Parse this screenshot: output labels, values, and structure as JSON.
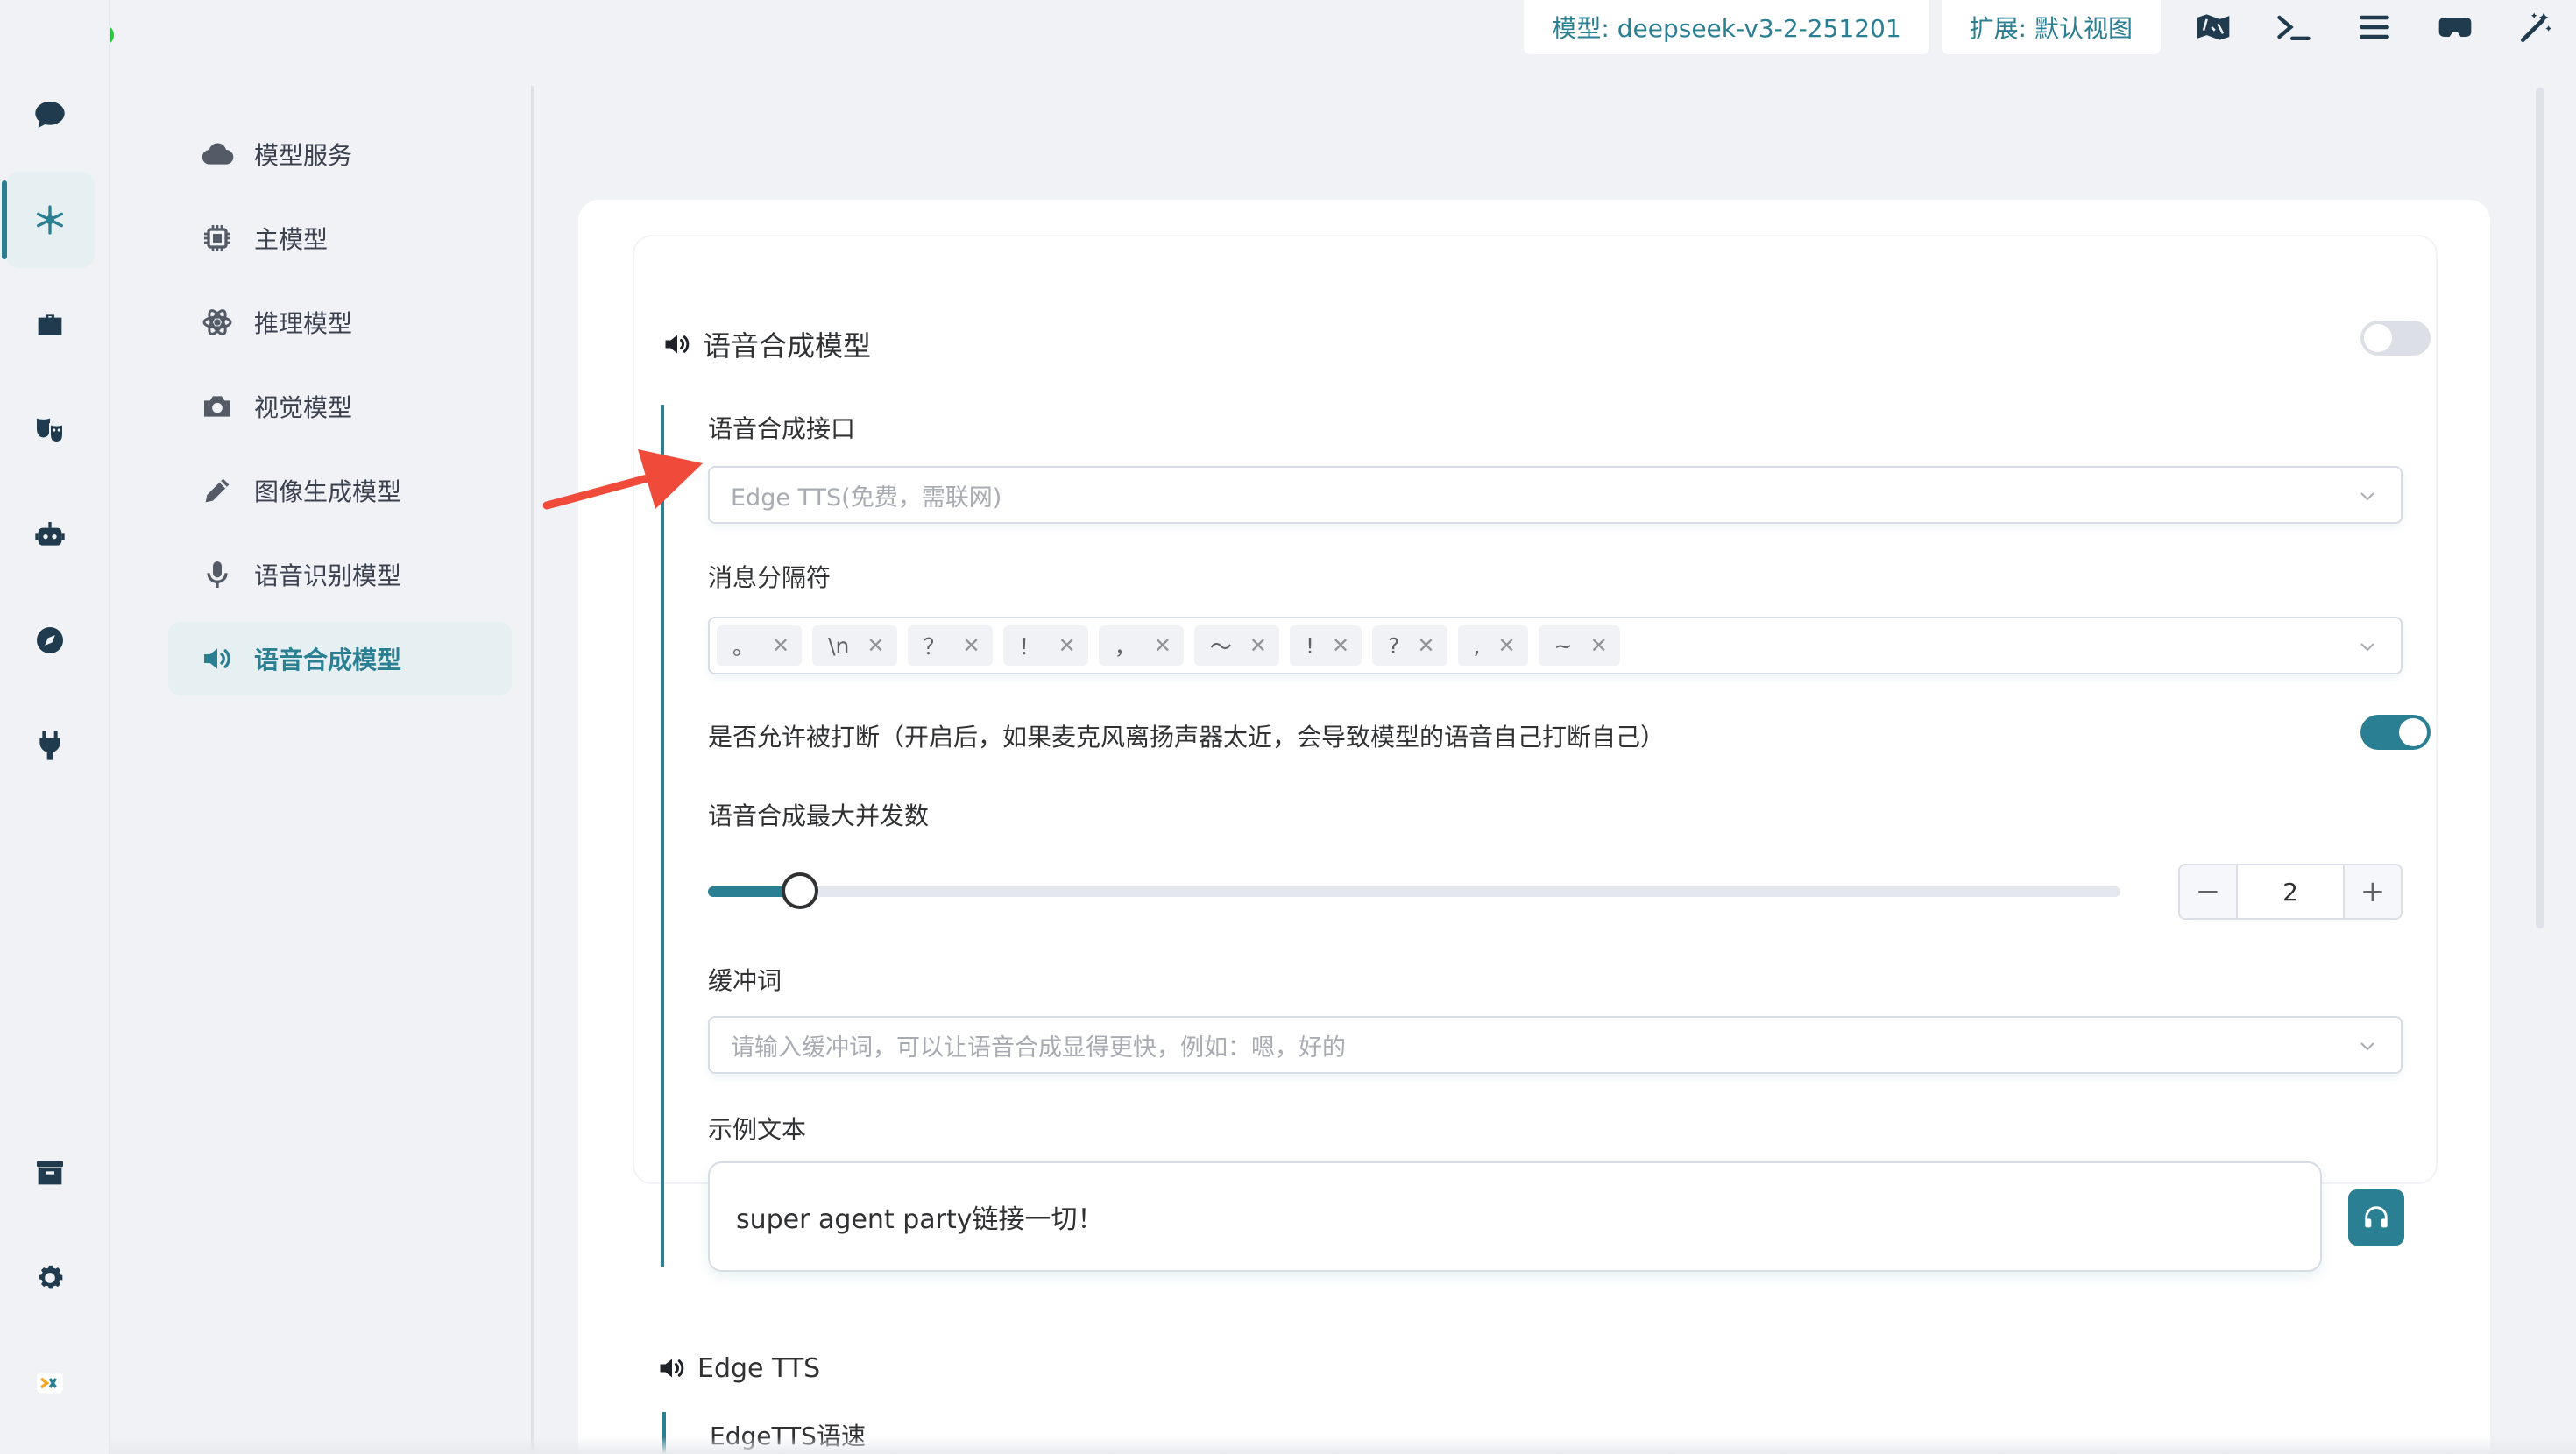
{
  "window": {
    "traffic_lights": [
      "close",
      "minimize",
      "zoom"
    ]
  },
  "topbar": {
    "model_label": "模型: deepseek-v3-2-251201",
    "extension_label": "扩展: 默认视图",
    "icons": [
      "map-icon",
      "terminal-icon",
      "menu-icon",
      "vr-headset-icon",
      "magic-wand-icon"
    ]
  },
  "rail": {
    "items": [
      {
        "name": "chat-icon",
        "active": false
      },
      {
        "name": "model-network-icon",
        "active": true
      },
      {
        "name": "toolbox-icon",
        "active": false
      },
      {
        "name": "masks-icon",
        "active": false
      },
      {
        "name": "robot-icon",
        "active": false
      },
      {
        "name": "compass-icon",
        "active": false
      },
      {
        "name": "plug-icon",
        "active": false
      },
      {
        "name": "archive-icon",
        "active": false
      },
      {
        "name": "settings-icon",
        "active": false
      },
      {
        "name": "logo-icon",
        "active": false
      }
    ]
  },
  "menu": {
    "items": [
      {
        "label": "模型服务",
        "icon": "cloud-icon",
        "active": false
      },
      {
        "label": "主模型",
        "icon": "chip-icon",
        "active": false
      },
      {
        "label": "推理模型",
        "icon": "atom-icon",
        "active": false
      },
      {
        "label": "视觉模型",
        "icon": "camera-icon",
        "active": false
      },
      {
        "label": "图像生成模型",
        "icon": "pencil-icon",
        "active": false
      },
      {
        "label": "语音识别模型",
        "icon": "microphone-icon",
        "active": false
      },
      {
        "label": "语音合成模型",
        "icon": "speaker-icon",
        "active": true
      }
    ]
  },
  "tts": {
    "title": "语音合成模型",
    "enabled": false,
    "interface_label": "语音合成接口",
    "interface_placeholder": "Edge TTS(免费，需联网)",
    "separator_label": "消息分隔符",
    "separators": [
      "。",
      "\\n",
      "？",
      "！",
      "，",
      "～",
      "!",
      "?",
      ",",
      "~"
    ],
    "interrupt_label": "是否允许被打断（开启后，如果麦克风离扬声器太近，会导致模型的语音自己打断自己）",
    "interrupt_enabled": true,
    "concurrency_label": "语音合成最大并发数",
    "concurrency_value": "2",
    "concurrency_min_label": "−",
    "concurrency_plus_label": "+",
    "concurrency_slider_fraction": 0.065,
    "buffer_label": "缓冲词",
    "buffer_placeholder": "请输入缓冲词，可以让语音合成显得更快，例如：嗯，好的",
    "sample_label": "示例文本",
    "sample_text": "super agent party链接一切！"
  },
  "edge_tts": {
    "title": "Edge TTS",
    "speed_label": "EdgeTTS语速"
  },
  "colors": {
    "accent": "#2a7f92",
    "annotation_arrow": "#f04b3a"
  }
}
